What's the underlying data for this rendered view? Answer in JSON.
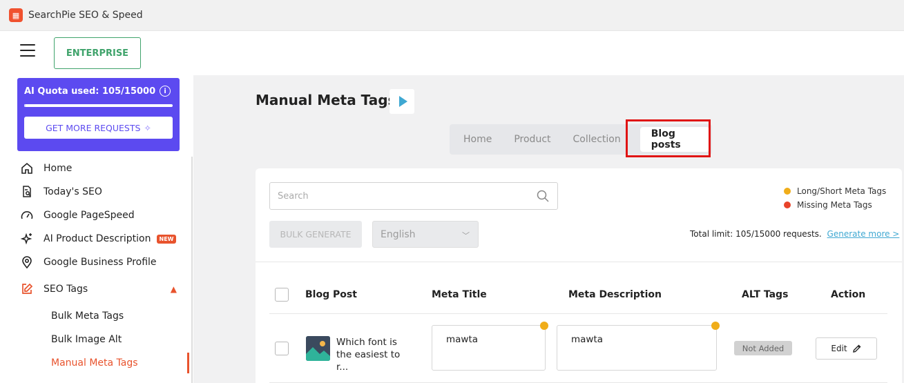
{
  "app": {
    "title": "SearchPie SEO & Speed"
  },
  "topbar": {
    "plan_label": "ENTERPRISE"
  },
  "quota": {
    "text": "AI Quota used: 105/15000",
    "used": 105,
    "total": 15000,
    "more_label": "GET MORE REQUESTS"
  },
  "nav": {
    "items": [
      {
        "label": "Home",
        "icon": "home-icon"
      },
      {
        "label": "Today's SEO",
        "icon": "document-search-icon"
      },
      {
        "label": "Google PageSpeed",
        "icon": "speedometer-icon"
      },
      {
        "label": "AI Product Description",
        "icon": "sparkles-icon",
        "badge": "NEW"
      },
      {
        "label": "Google Business Profile",
        "icon": "map-pin-icon"
      },
      {
        "label": "SEO Tags",
        "icon": "edit-square-icon"
      }
    ],
    "sub_items": [
      "Bulk Meta Tags",
      "Bulk Image Alt",
      "Manual Meta Tags"
    ]
  },
  "page": {
    "title": "Manual Meta Tags"
  },
  "tabs": [
    "Home",
    "Product",
    "Collection",
    "Blog posts"
  ],
  "toolbar": {
    "search_placeholder": "Search",
    "bulk_label": "BULK GENERATE",
    "language": "English",
    "limit_text": "Total limit: 105/15000 requests.",
    "generate_more": "Generate more >"
  },
  "legend": [
    {
      "label": "Long/Short Meta Tags",
      "color": "#f0ad19"
    },
    {
      "label": "Missing Meta Tags",
      "color": "#e8432a"
    }
  ],
  "table": {
    "headers": [
      "Blog Post",
      "Meta Title",
      "Meta Description",
      "ALT Tags",
      "Action"
    ],
    "rows": [
      {
        "post": "Which font is the easiest to r...",
        "meta_title": "mawta",
        "meta_description": "mawta",
        "alt_tags": "Not Added",
        "action": "Edit"
      }
    ]
  }
}
